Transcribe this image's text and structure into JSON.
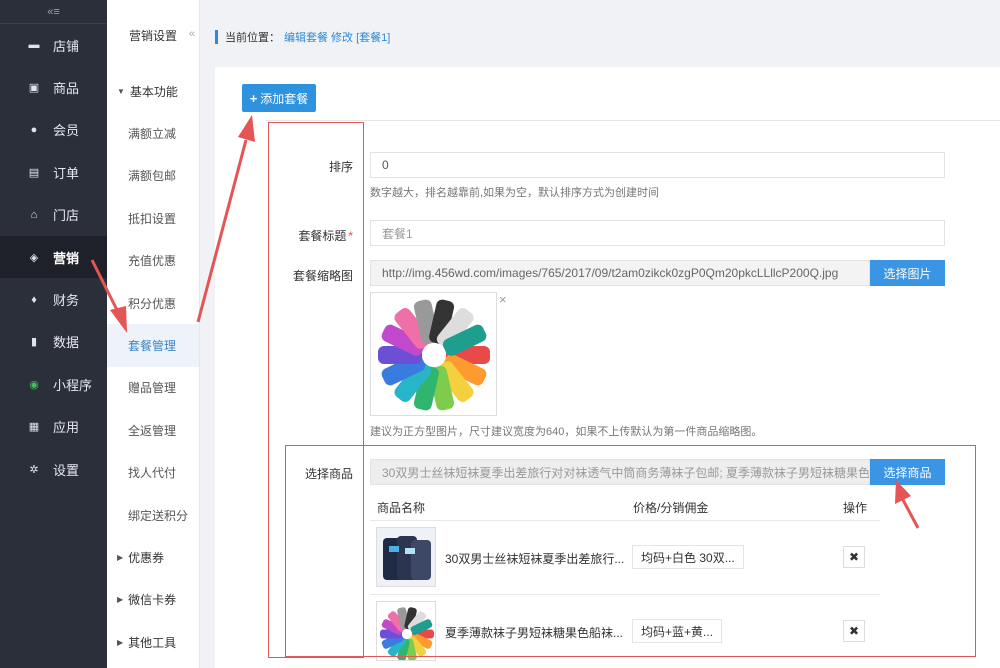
{
  "leftnav": {
    "collapse_label": "«≡",
    "items": [
      {
        "label": "店铺",
        "icon": "store-icon",
        "glyph": "▬"
      },
      {
        "label": "商品",
        "icon": "goods-icon",
        "glyph": "▣"
      },
      {
        "label": "会员",
        "icon": "member-icon",
        "glyph": "●"
      },
      {
        "label": "订单",
        "icon": "order-icon",
        "glyph": "▤"
      },
      {
        "label": "门店",
        "icon": "shop-icon",
        "glyph": "⌂"
      },
      {
        "label": "营销",
        "icon": "gift-icon",
        "glyph": "◈"
      },
      {
        "label": "财务",
        "icon": "money-bag-icon",
        "glyph": "♦"
      },
      {
        "label": "数据",
        "icon": "chart-icon",
        "glyph": "▮"
      },
      {
        "label": "小程序",
        "icon": "mini-program-icon",
        "glyph": "◉"
      },
      {
        "label": "应用",
        "icon": "apps-icon",
        "glyph": "▦"
      },
      {
        "label": "设置",
        "icon": "gear-icon",
        "glyph": "✲"
      }
    ]
  },
  "subnav": {
    "title": "营销设置",
    "collapse": "«",
    "group_basic": "基本功能",
    "basic_items": [
      "满额立减",
      "满额包邮",
      "抵扣设置",
      "充值优惠",
      "积分优惠",
      "套餐管理",
      "赠品管理",
      "全返管理",
      "找人代付",
      "绑定送积分"
    ],
    "group_coupon": "优惠券",
    "group_wxcard": "微信卡券",
    "group_other": "其他工具"
  },
  "breadcrumb": {
    "prefix": "当前位置：",
    "link": "编辑套餐 修改 [套餐1]"
  },
  "toolbar": {
    "add_label": "添加套餐"
  },
  "form": {
    "sort_label": "排序",
    "sort_value": "0",
    "sort_hint": "数字越大，排名越靠前,如果为空，默认排序方式为创建时间",
    "title_label": "套餐标题",
    "title_required": "*",
    "title_placeholder": "套餐1",
    "thumb_label": "套餐缩略图",
    "thumb_url": "http://img.456wd.com/images/765/2017/09/t2am0zikck0zgP0Qm20pkcLLllcP200Q.jpg",
    "thumb_button": "选择图片",
    "thumb_close": "×",
    "thumb_hint": "建议为正方型图片，尺寸建议宽度为640，如果不上传默认为第一件商品缩略图。",
    "goods_label": "选择商品",
    "goods_value": "30双男士丝袜短袜夏季出差旅行对对袜透气中筒商务薄袜子包邮; 夏季薄款袜子男短袜糖果色船袜",
    "goods_button": "选择商品"
  },
  "table": {
    "headers": {
      "name": "商品名称",
      "price": "价格/分销佣金",
      "action": "操作"
    },
    "rows": [
      {
        "name": "30双男士丝袜短袜夏季出差旅行...",
        "price": "均码+白色 30双...",
        "delete": "✖"
      },
      {
        "name": "夏季薄款袜子男短袜糖果色船袜...",
        "price": "均码+蓝+黄...",
        "delete": "✖"
      }
    ]
  },
  "colors": {
    "sidebar": "#2b2f3a",
    "accent": "#2e93de",
    "annotation": "#e45555"
  }
}
